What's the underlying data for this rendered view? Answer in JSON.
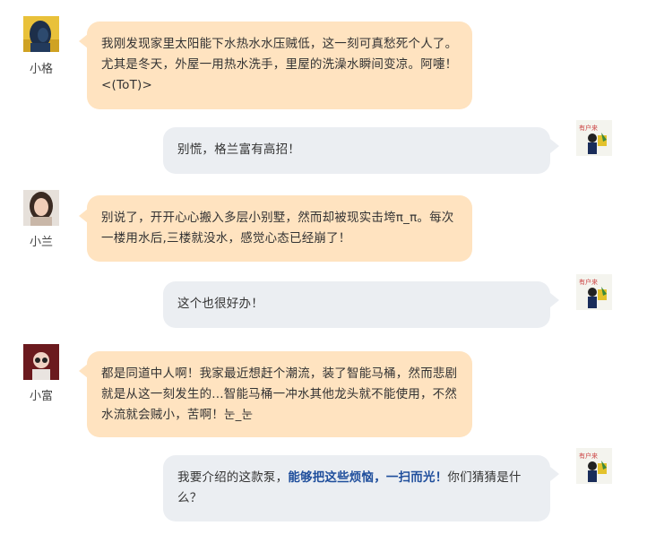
{
  "messages": [
    {
      "sender": "小格",
      "side": "left",
      "text": "我刚发现家里太阳能下水热水水压贼低，这一刻可真愁死个人了。尤其是冬天，外屋一用热水洗手，里屋的洗澡水瞬间变凉。阿嚏！<(ToT)>"
    },
    {
      "side": "right",
      "text": "别慌，格兰富有高招！"
    },
    {
      "sender": "小兰",
      "side": "left",
      "text": "别说了，开开心心搬入多层小别墅，然而却被现实击垮π_π。每次一楼用水后,三楼就没水，感觉心态已经崩了！"
    },
    {
      "side": "right",
      "text": "这个也很好办！"
    },
    {
      "sender": "小富",
      "side": "left",
      "text": "都是同道中人啊！我家最近想赶个潮流，装了智能马桶，然而悲剧就是从这一刻发生的...智能马桶一冲水其他龙头就不能使用，不然水流就会贼小，苦啊！눈_눈"
    },
    {
      "side": "right",
      "text_before": "我要介绍的这款泵，",
      "text_highlight": "能够把这些烦恼，一扫而光！",
      "text_after": "你们猜猜是什么？"
    }
  ],
  "colors": {
    "left_bubble": "#ffe3c0",
    "right_bubble": "#ebeef2",
    "highlight_text": "#1f4e9c"
  },
  "icons": {
    "avatar_1": "user-avatar-photo",
    "avatar_2": "user-avatar-photo",
    "avatar_3": "user-avatar-photo",
    "agent_avatar": "brand-avatar-cartoon"
  }
}
